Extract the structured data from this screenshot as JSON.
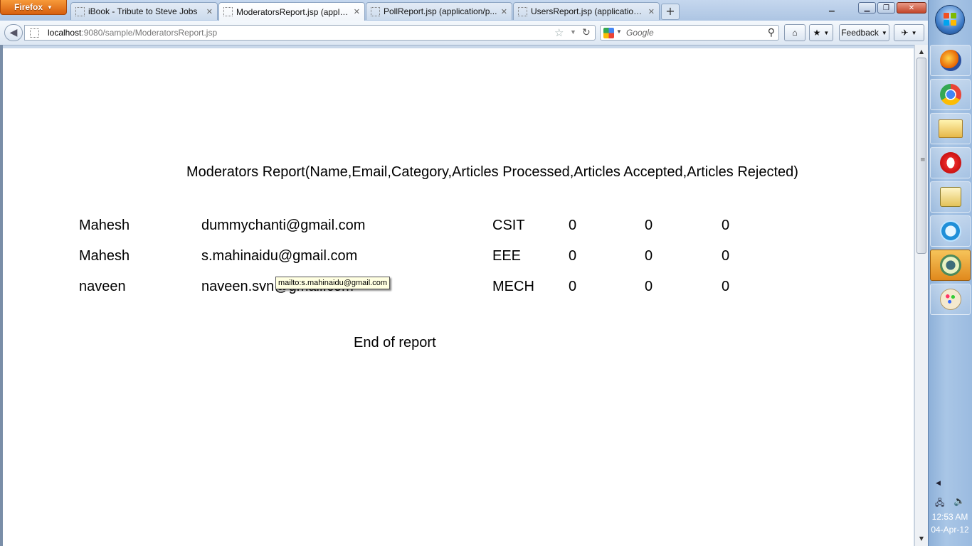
{
  "browser": {
    "menu_label": "Firefox",
    "tabs": [
      {
        "title": "iBook - Tribute to Steve Jobs"
      },
      {
        "title": "ModeratorsReport.jsp (applic..."
      },
      {
        "title": "PollReport.jsp (application/p..."
      },
      {
        "title": "UsersReport.jsp (application/..."
      }
    ],
    "new_tab_label": "+",
    "url_host": "localhost",
    "url_rest": ":9080/sample/ModeratorsReport.jsp",
    "search_placeholder": "Google",
    "feedback_label": "Feedback"
  },
  "report": {
    "title": "Moderators Report(Name,Email,Category,Articles Processed,Articles Accepted,Articles Rejected)",
    "rows": [
      {
        "name": "Mahesh",
        "email": "dummychanti@gmail.com",
        "category": "CSIT",
        "processed": "0",
        "accepted": "0",
        "rejected": "0"
      },
      {
        "name": "Mahesh",
        "email": "s.mahinaidu@gmail.com",
        "category": "EEE",
        "processed": "0",
        "accepted": "0",
        "rejected": "0"
      },
      {
        "name": "naveen",
        "email": "naveen.svn@gmail.com",
        "category": "MECH",
        "processed": "0",
        "accepted": "0",
        "rejected": "0"
      }
    ],
    "footer": "End of report"
  },
  "tooltip": "mailto:s.mahinaidu@gmail.com",
  "taskbar": {
    "items": [
      "firefox-icon",
      "chrome-icon",
      "folder-icon",
      "opera-icon",
      "network-icon",
      "app-icon",
      "app-icon-active",
      "paint-icon"
    ]
  },
  "clock": {
    "time": "12:53 AM",
    "date": "04-Apr-12"
  }
}
